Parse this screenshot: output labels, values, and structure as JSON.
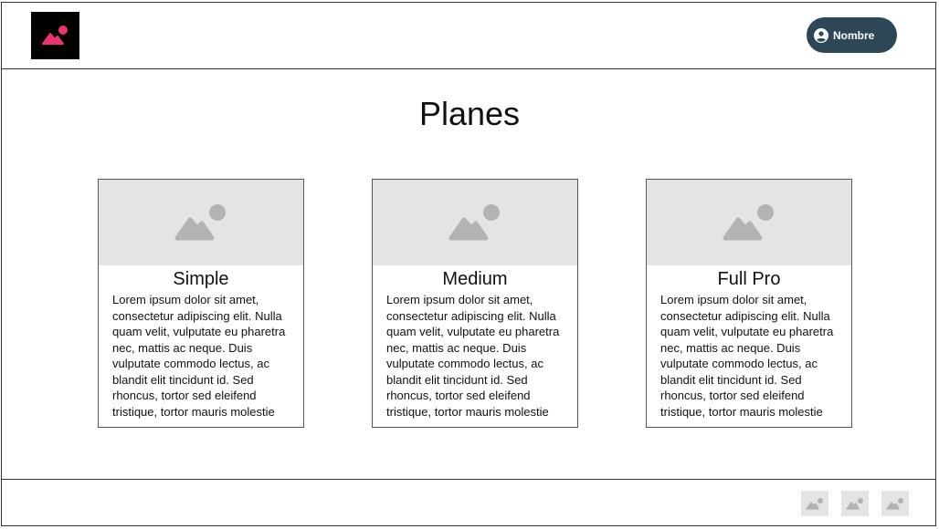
{
  "header": {
    "logo_icon": "image-icon",
    "logo_accent": "#e8346f",
    "user_button": {
      "icon": "account-circle-icon",
      "label": "Nombre",
      "color": "#2d4756"
    }
  },
  "main": {
    "title": "Planes",
    "plans": [
      {
        "name": "Simple",
        "image_icon": "image-placeholder-icon",
        "description": "Lorem ipsum dolor sit amet, consectetur adipiscing elit. Nulla quam velit, vulputate eu pharetra nec, mattis ac neque. Duis vulputate commodo lectus, ac blandit elit tincidunt id. Sed rhoncus, tortor sed eleifend tristique, tortor mauris molestie"
      },
      {
        "name": "Medium",
        "image_icon": "image-placeholder-icon",
        "description": "Lorem ipsum dolor sit amet, consectetur adipiscing elit. Nulla quam velit, vulputate eu pharetra nec, mattis ac neque. Duis vulputate commodo lectus, ac blandit elit tincidunt id. Sed rhoncus, tortor sed eleifend tristique, tortor mauris molestie"
      },
      {
        "name": "Full Pro",
        "image_icon": "image-placeholder-icon",
        "description": "Lorem ipsum dolor sit amet, consectetur adipiscing elit. Nulla quam velit, vulputate eu pharetra nec, mattis ac neque. Duis vulputate commodo lectus, ac blandit elit tincidunt id. Sed rhoncus, tortor sed eleifend tristique, tortor mauris molestie"
      }
    ]
  },
  "footer": {
    "icons": [
      "image-icon",
      "image-icon",
      "image-icon"
    ]
  }
}
